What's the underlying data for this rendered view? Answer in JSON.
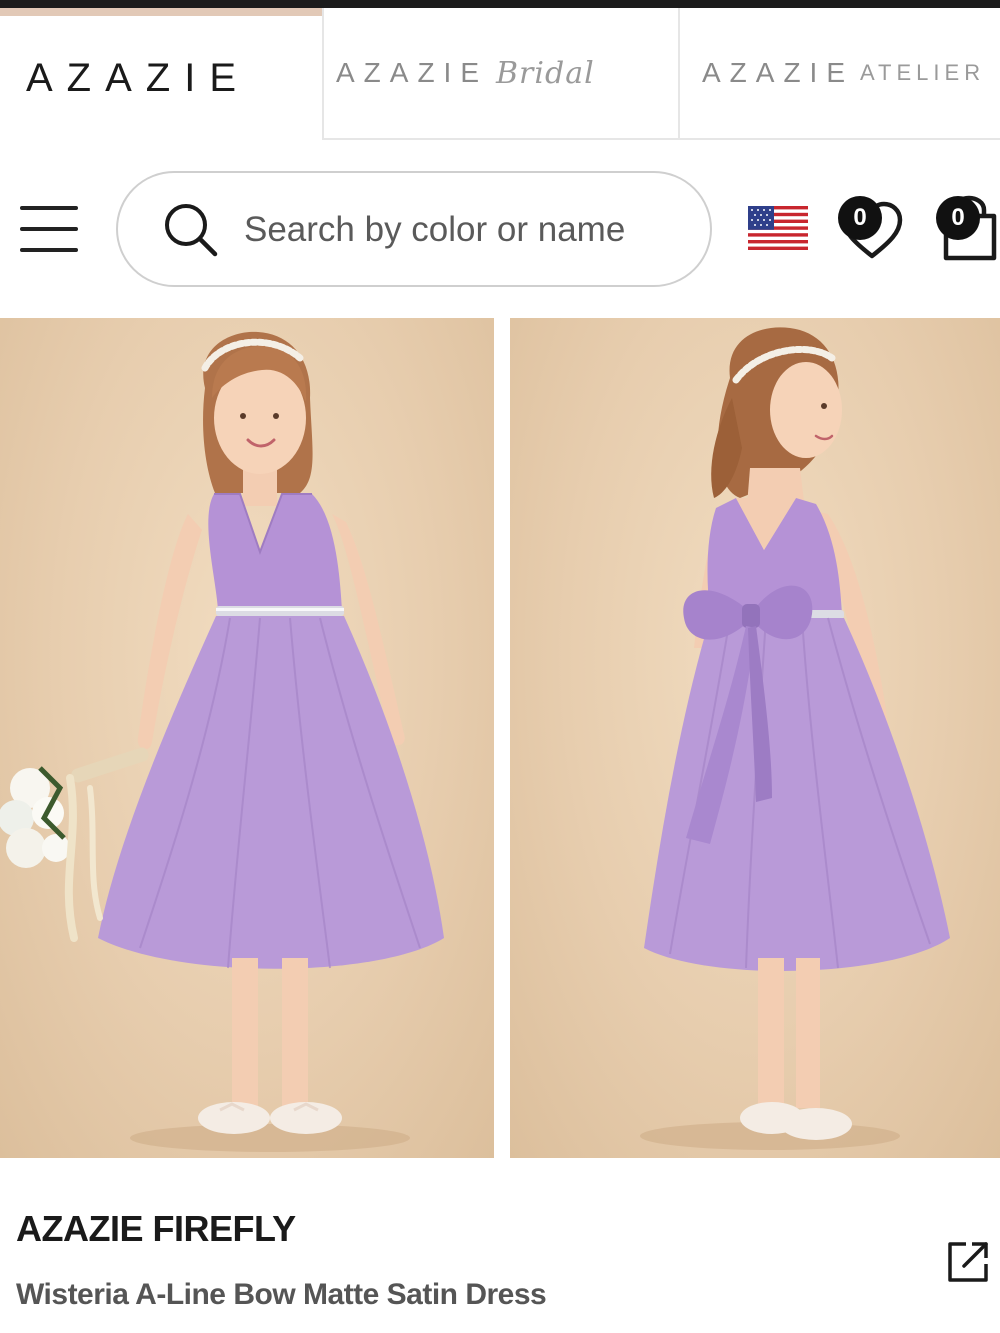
{
  "header": {
    "brand": "AZAZIE",
    "tabs": [
      {
        "wordmark": "AZAZIE",
        "script": "Bridal"
      },
      {
        "wordmark": "AZAZIE",
        "sub": "ATELIER"
      }
    ]
  },
  "search": {
    "placeholder": "Search by color or name"
  },
  "toolbar": {
    "region_icon": "us-flag-icon",
    "wishlist_count": "0",
    "bag_count": "0"
  },
  "gallery": {
    "images": [
      {
        "icon": "dress-front-photo"
      },
      {
        "icon": "dress-back-photo"
      }
    ]
  },
  "product": {
    "brand": "AZAZIE FIREFLY",
    "name": "Wisteria A-Line Bow Matte Satin Dress"
  },
  "colors": {
    "dress": "#b592d6",
    "background": "#e7cdae",
    "text": "#1a1a1a"
  }
}
